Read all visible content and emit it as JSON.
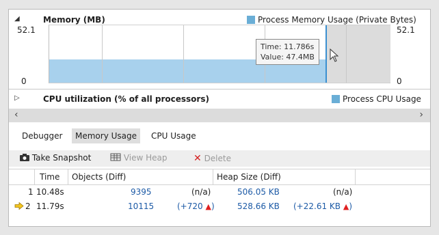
{
  "memory_section": {
    "title": "Memory (MB)",
    "legend": "Process Memory Usage (Private Bytes)",
    "y_max_left": "52.1",
    "y_min_left": "0",
    "y_max_right": "52.1",
    "y_min_right": "0",
    "tooltip_time": "Time: 11.786s",
    "tooltip_value": "Value: 47.4MB",
    "series_color": "#a8d1ed",
    "marker_color": "#3a8fd1"
  },
  "cpu_section": {
    "title": "CPU utilization (% of all processors)",
    "legend": "Process CPU Usage"
  },
  "tabs": [
    {
      "label": "Debugger"
    },
    {
      "label": "Memory Usage"
    },
    {
      "label": "CPU Usage"
    }
  ],
  "toolbar": {
    "take_snapshot": "Take Snapshot",
    "view_heap": "View Heap",
    "delete": "Delete"
  },
  "table": {
    "headers": [
      "Time",
      "Objects (Diff)",
      "Heap Size (Diff)"
    ],
    "rows": [
      {
        "id": "1",
        "time": "10.48s",
        "objects": "9395",
        "objects_diff": "(n/a)",
        "heap": "506.05 KB",
        "heap_diff": "(n/a)"
      },
      {
        "id": "2",
        "time": "11.79s",
        "objects": "10115",
        "objects_diff": "(+720",
        "heap": "528.66 KB",
        "heap_diff": "(+22.61 KB",
        "close": ")"
      }
    ]
  }
}
